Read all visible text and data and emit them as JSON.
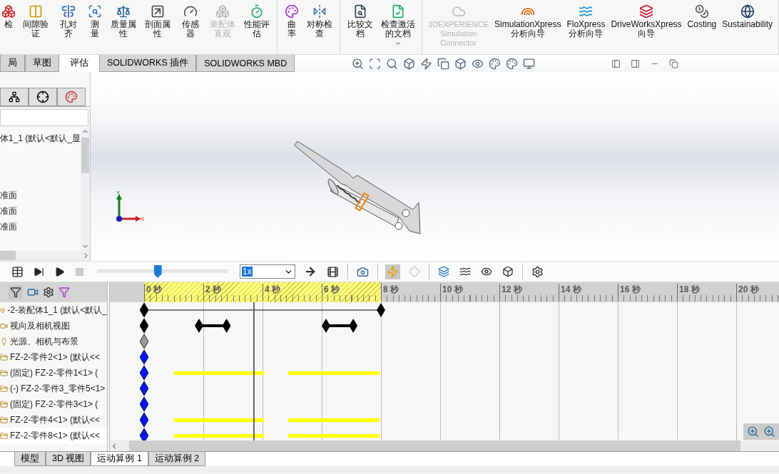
{
  "ribbon": {
    "groups": [
      {
        "items": [
          {
            "label": "检",
            "disabled": false
          },
          {
            "label": "间隙验证",
            "disabled": false
          },
          {
            "label": "孔对齐",
            "disabled": false
          },
          {
            "label": "测量",
            "disabled": false
          },
          {
            "label": "质量属性",
            "disabled": false
          },
          {
            "label": "剖面属性",
            "disabled": false
          },
          {
            "label": "传感器",
            "disabled": false
          },
          {
            "label": "装配体直观",
            "disabled": true
          },
          {
            "label": "性能评估",
            "disabled": false
          }
        ]
      },
      {
        "items": [
          {
            "label": "曲率",
            "disabled": false
          },
          {
            "label": "对称检查",
            "disabled": false
          }
        ]
      },
      {
        "items": [
          {
            "label": "比较文档",
            "disabled": false
          },
          {
            "label": "检查激活的文档",
            "disabled": false,
            "dropdown": true
          }
        ]
      },
      {
        "items": [
          {
            "label": "3DEXPERIENCE Simulation Connector",
            "disabled": true
          },
          {
            "label": "SimulationXpress 分析向导",
            "disabled": false
          },
          {
            "label": "FloXpress 分析向导",
            "disabled": false
          },
          {
            "label": "DriveWorksXpress 向导",
            "disabled": false
          },
          {
            "label": "Costing",
            "disabled": false
          },
          {
            "label": "Sustainability",
            "disabled": false
          }
        ]
      }
    ]
  },
  "command_tabs": [
    {
      "label": "局",
      "selected": false
    },
    {
      "label": "草图",
      "selected": false
    },
    {
      "label": "评估",
      "selected": true
    },
    {
      "label": "SOLIDWORKS 插件",
      "selected": false
    },
    {
      "label": "SOLIDWORKS MBD",
      "selected": false
    }
  ],
  "feature_tree": [
    {
      "label": "体1_1  (默认<默认_显"
    },
    {
      "label": "准面"
    },
    {
      "label": "准面"
    },
    {
      "label": "准面"
    }
  ],
  "view": {
    "triad": {
      "x": "X",
      "y": "Y"
    }
  },
  "motion_toolbar": {
    "slider": {
      "level": 0.46
    },
    "speed": "1x"
  },
  "timeline": {
    "ruler": [
      "0 秒",
      "2 秒",
      "4 秒",
      "6 秒",
      "8 秒",
      "10 秒",
      "12 秒",
      "14 秒",
      "16 秒",
      "18 秒",
      "20 秒"
    ],
    "rows": [
      {
        "label": "-2-装配体1_1  (默认<默认_",
        "kind": "duration"
      },
      {
        "label": "视向及相机视图",
        "kind": "camera"
      },
      {
        "label": "光源、相机与布景",
        "kind": "light"
      },
      {
        "label": "FZ-2-零件2<1> (默认<<",
        "kind": "part"
      },
      {
        "label": "(固定) FZ-2-零件1<1> (",
        "kind": "moving-part"
      },
      {
        "label": "(-) FZ-2-零件3_零件5<1>",
        "kind": "part"
      },
      {
        "label": "(固定) FZ-2-零件3<1> (",
        "kind": "part"
      },
      {
        "label": "FZ-2-零件4<1> (默认<<",
        "kind": "moving-part"
      },
      {
        "label": "FZ-2-零件8<1> (默认<<",
        "kind": "moving-part"
      }
    ]
  },
  "bottom_tabs": [
    {
      "label": "模型",
      "selected": false
    },
    {
      "label": "3D 视图",
      "selected": false
    },
    {
      "label": "运动算例 1",
      "selected": true
    },
    {
      "label": "运动算例 2",
      "selected": false
    }
  ]
}
